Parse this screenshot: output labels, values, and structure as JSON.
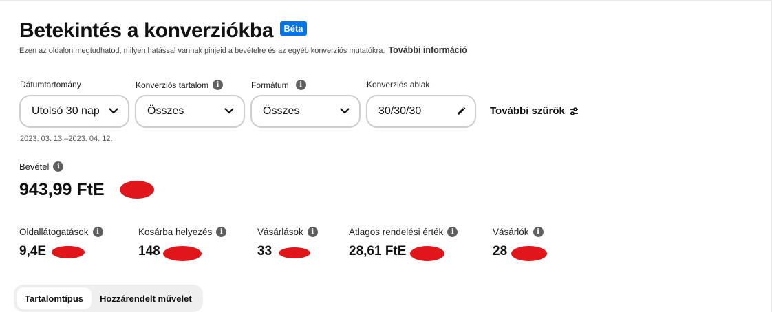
{
  "header": {
    "title": "Betekintés a konverziókba",
    "badge": "Béta",
    "subtitle": "Ezen az oldalon megtudhatod, milyen hatással vannak pinjeid a bevételre és az egyéb konverziós mutatókra.",
    "more_info_link": "További információ"
  },
  "filters": {
    "date_range": {
      "label": "Dátumtartomány",
      "value": "Utolsó 30 nap"
    },
    "conversion_content": {
      "label": "Konverziós tartalom",
      "value": "Összes"
    },
    "format": {
      "label": "Formátum",
      "value": "Összes"
    },
    "conversion_window": {
      "label": "Konverziós ablak",
      "value": "30/30/30"
    },
    "more_filters": "További szűrők"
  },
  "date_range_text": "2023. 03. 13.–2023. 04. 12.",
  "revenue": {
    "label": "Bevétel",
    "value": "943,99 FtE"
  },
  "metrics": [
    {
      "label": "Oldallátogatások",
      "value": "9,4E"
    },
    {
      "label": "Kosárba helyezés",
      "value": "148"
    },
    {
      "label": "Vásárlások",
      "value": "33"
    },
    {
      "label": "Átlagos rendelési érték",
      "value": "28,61 FtE"
    },
    {
      "label": "Vásárlók",
      "value": "28"
    }
  ],
  "tabs": [
    {
      "label": "Tartalomtípus",
      "active": true
    },
    {
      "label": "Hozzárendelt művelet",
      "active": false
    }
  ],
  "icons": {
    "info": "info-icon",
    "chevron": "chevron-down-icon",
    "edit": "pencil-icon",
    "filters": "sliders-icon"
  },
  "colors": {
    "badge": "#0074e8",
    "redaction": "#e0161b",
    "input_border": "#cdcdcd",
    "tab_background": "#efefef"
  }
}
